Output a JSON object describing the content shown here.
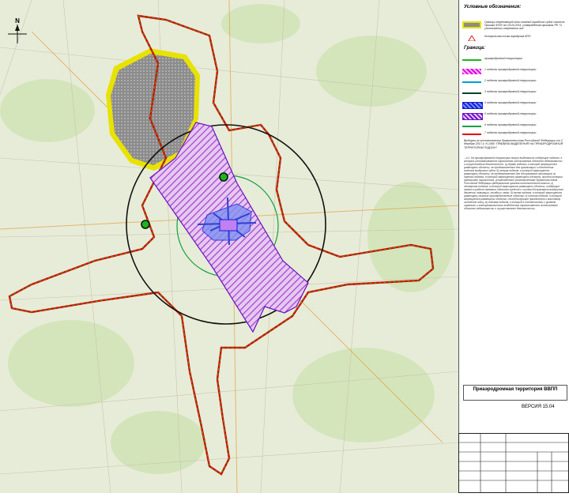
{
  "legend": {
    "title": "Условные обозначения:",
    "items": [
      {
        "label": "Граница опережающей зоны главной городских судов согласно Приказа ФГБУ от 04.04.2014, утверждённая приказом РФ \"О установлении опережения зон\"",
        "color": "#e8e200"
      },
      {
        "label": "Контрольная точка аэродрома ВПП",
        "color": "#d00000"
      }
    ]
  },
  "bounds": {
    "title": "Граница:",
    "items": [
      {
        "label": "приаэродромной территории",
        "color": "#18b818"
      },
      {
        "label": "1 подзоны приаэродромной территории",
        "color": "#e000e0"
      },
      {
        "label": "2 подзоны приаэродромной территории",
        "color": "#00a0d0"
      },
      {
        "label": "3 подзоны приаэродромной территории",
        "color": "#104020"
      },
      {
        "label": "4 подзоны приаэродромной территории",
        "color": "#1020e0"
      },
      {
        "label": "5 подзоны приаэродромной территории",
        "color": "#7010d0"
      },
      {
        "label": "6 подзоны приаэродромной территории",
        "color": "#10a040"
      },
      {
        "label": "7 подзоны приаэродромной территории",
        "color": "#e00000"
      }
    ]
  },
  "decree": {
    "header": "Выборка из постановления Правительства Российской Федерации от 2 декабря 2017 г. N 1460 \"ПРАВИЛА ВЫДЕЛЕНИЯ НА ПРИАЭРОДРОМНОЙ ТЕРРИТОРИИ ПОДЗОН\"",
    "body": "...п.2. На приаэродромной территории могут выделяться следующие подзоны, в которых устанавливаются ограничения использования объектов недвижимости и осуществления деятельности: а) первая подзона, в которой запрещается размещать объекты, не предназначенные для организации и обеспечения полетов воздушных судов; б) вторая подзона, в которой запрещается размещать объекты, не предназначенные для обслуживания пассажиров; в) третья подзона, в которой запрещается размещать объекты, высота которых превышает ограничения, установленные уполномоченным Правительством Российской Федерации федеральным органом исполнительной власти; г) четвертая подзона, в которой запрещается размещать объекты, создающие помехи в работе наземных объектов средств и систем обслуживания воздушного движения, навигации, посадки и связи; д) пятая подзона, в которой запрещается размещать опасные производственные объекты; е) шестая подзона, в которой запрещается размещать объекты, способствующие привлечению и массовому скоплению птиц; ж) седьмая подзона, в которой в соответствии с уровнем шумового и электромагнитного воздействия ограничивается использование объектов недвижимости и осуществление деятельности..."
  },
  "title_block": {
    "title": "Приаэродромная территория ВВПП",
    "version": "ВЕРСИЯ 15.04"
  },
  "compass": {
    "label": "N"
  }
}
